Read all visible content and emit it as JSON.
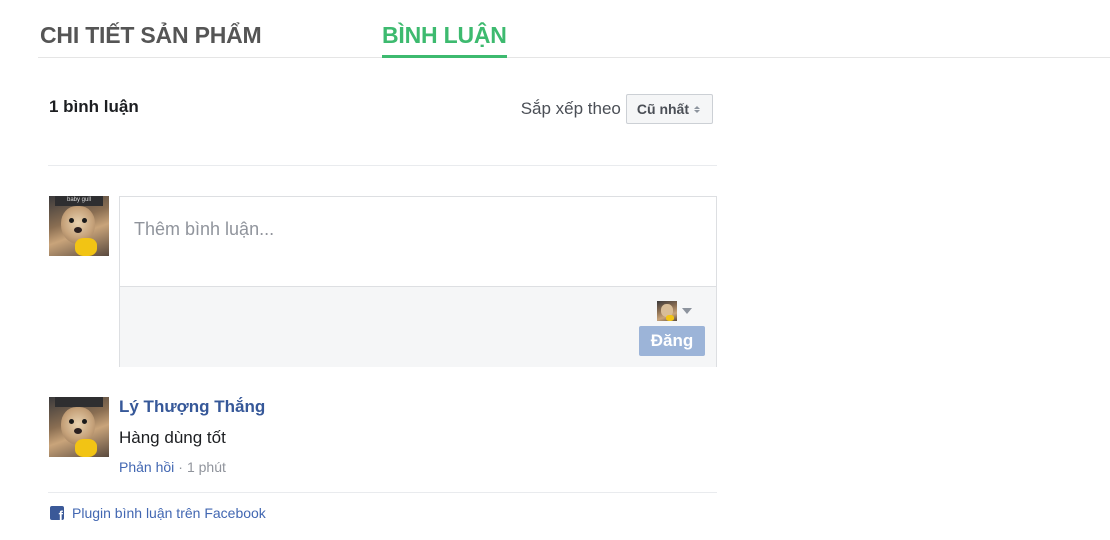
{
  "tabs": {
    "details_label": "CHI TIẾT SẢN PHẨM",
    "comments_label": "BÌNH LUẬN"
  },
  "comments": {
    "count_label": "1 bình luận",
    "sort_label": "Sắp xếp theo",
    "sort_value": "Cũ nhất",
    "composer": {
      "placeholder": "Thêm bình luận...",
      "post_label": "Đăng",
      "avatar_caption": "baby gull"
    },
    "items": [
      {
        "author": "Lý Thượng Thắng",
        "text": "Hàng dùng tốt",
        "reply_label": "Phản hồi",
        "separator": "·",
        "time": "1 phút"
      }
    ],
    "footer_label": "Plugin bình luận trên Facebook"
  },
  "colors": {
    "active_tab": "#3dba6f",
    "link": "#365899",
    "post_button": "#9cb4d8",
    "facebook": "#3b5998"
  },
  "icons": [
    "sort-arrows-icon",
    "chevron-down-icon",
    "facebook-icon"
  ]
}
